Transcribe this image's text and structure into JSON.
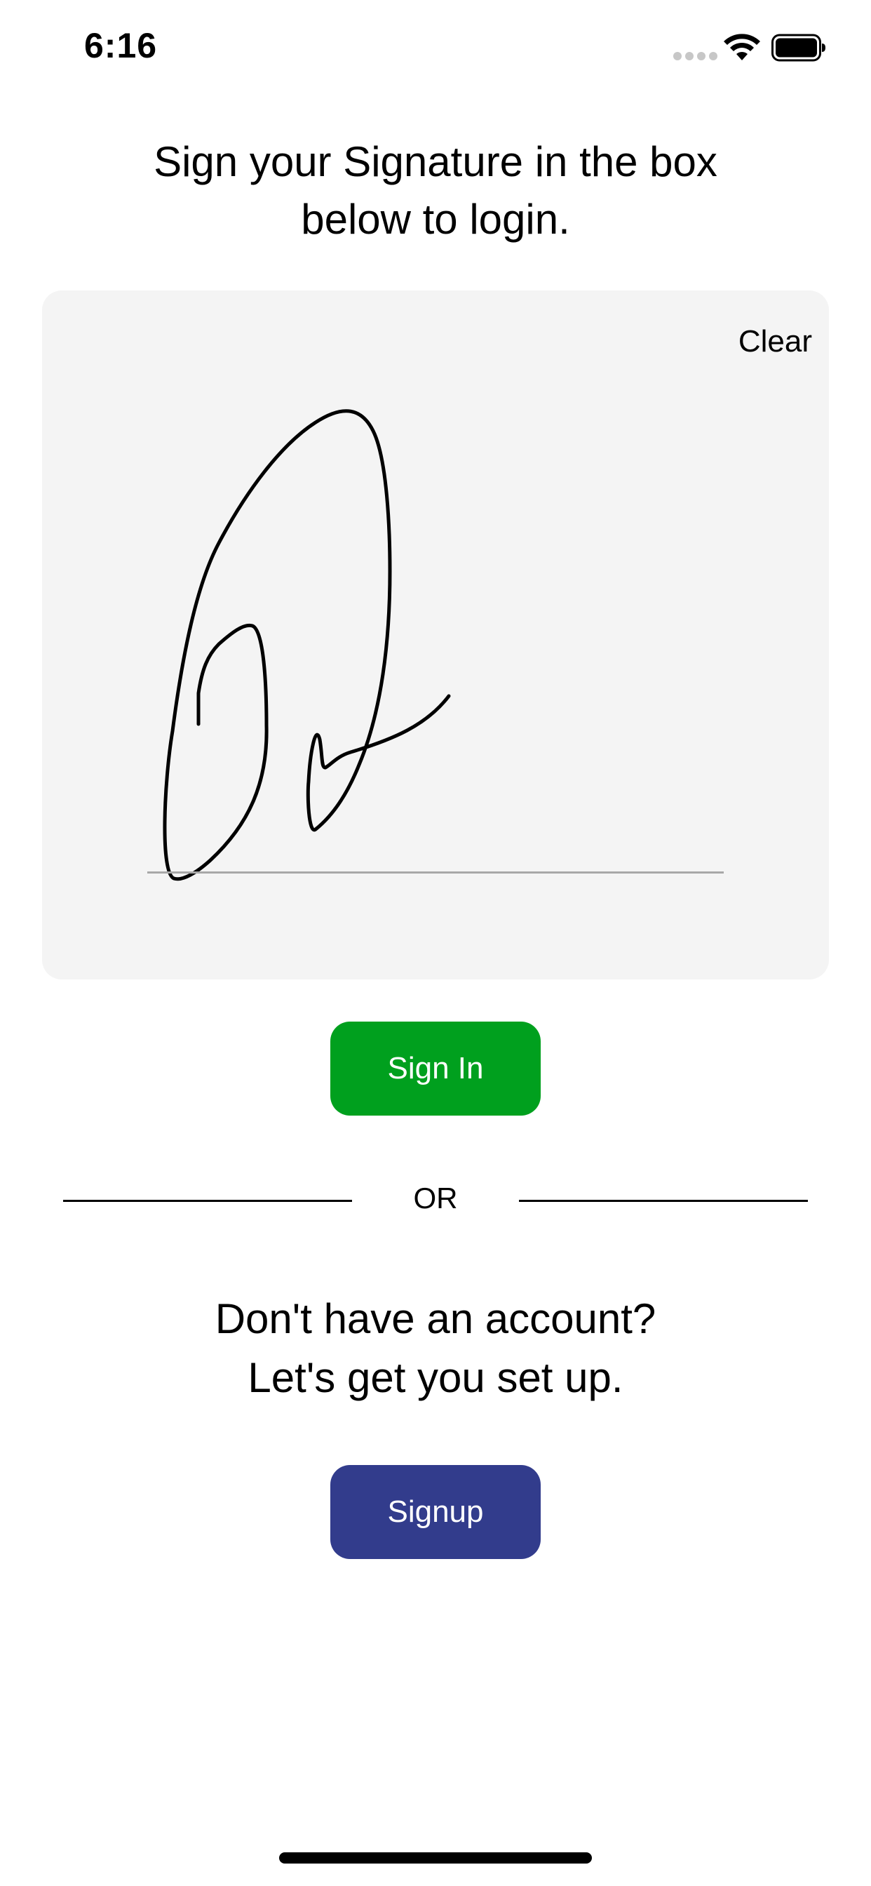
{
  "status_bar": {
    "time": "6:16"
  },
  "instruction": {
    "line1": "Sign your Signature in the box",
    "line2": "below to login."
  },
  "signature_pad": {
    "clear_label": "Clear",
    "background": "#f4f4f4"
  },
  "sign_in": {
    "label": "Sign In",
    "color": "#00a01e"
  },
  "divider": {
    "label": "OR"
  },
  "signup_prompt": {
    "line1": "Don't have an account?",
    "line2": "Let's get you set up."
  },
  "signup": {
    "label": "Signup",
    "color": "#323c8c"
  },
  "icons": {
    "signal": "cellular-signal-icon",
    "wifi": "wifi-icon",
    "battery": "battery-icon"
  }
}
